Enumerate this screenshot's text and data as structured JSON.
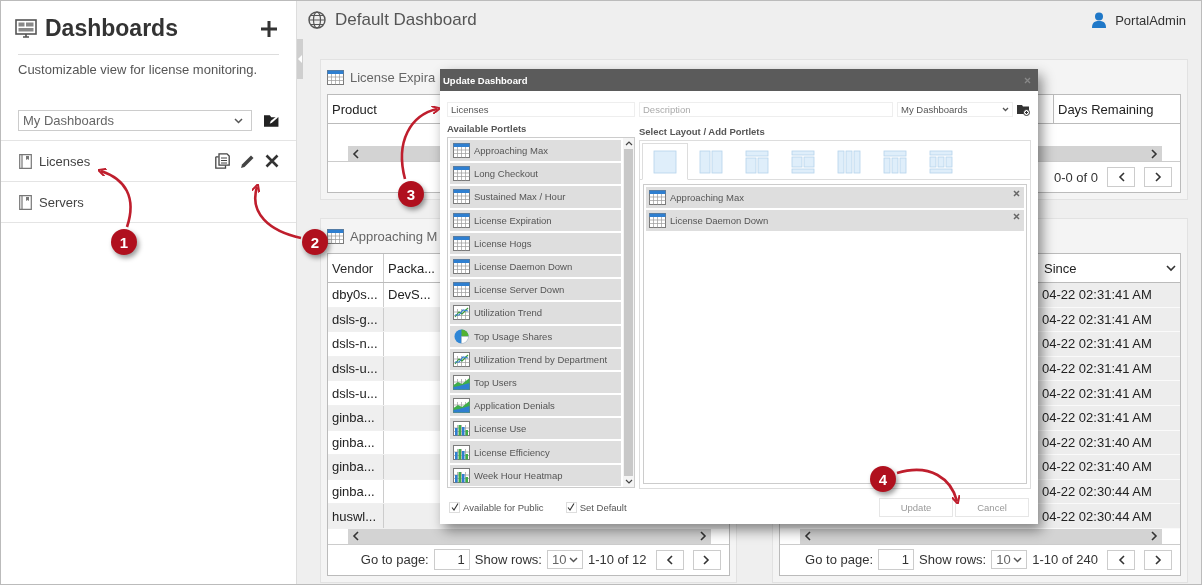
{
  "sidebar": {
    "title": "Dashboards",
    "description": "Customizable view for license monitoring.",
    "filter": {
      "value": "My Dashboards"
    },
    "items": [
      {
        "label": "Licenses",
        "actions": true
      },
      {
        "label": "Servers",
        "actions": false
      }
    ]
  },
  "header": {
    "title": "Default Dashboard",
    "user": "PortalAdmin"
  },
  "top_panel": {
    "title": "License Expira",
    "columns": [
      "Product",
      "Days Remaining"
    ],
    "pager": {
      "range": "0-0 of 0"
    }
  },
  "left_panel": {
    "title": "Approaching M",
    "columns": [
      "Vendor",
      "Packa..."
    ],
    "rows": [
      {
        "vendor": "dby0s...",
        "package": "DevS..."
      },
      {
        "vendor": "dsls-g..."
      },
      {
        "vendor": "dsls-n..."
      },
      {
        "vendor": "dsls-u..."
      },
      {
        "vendor": "dsls-u..."
      },
      {
        "vendor": "ginba..."
      },
      {
        "vendor": "ginba..."
      },
      {
        "vendor": "ginba..."
      },
      {
        "vendor": "ginba..."
      },
      {
        "vendor": "huswl..."
      }
    ],
    "pager": {
      "goto_label": "Go to page:",
      "page": "1",
      "rows_label": "Show rows:",
      "rows": "10",
      "range": "1-10 of 12"
    }
  },
  "right_panel": {
    "column": "Since",
    "rows": [
      "04-22 02:31:41 AM",
      "04-22 02:31:41 AM",
      "04-22 02:31:41 AM",
      "04-22 02:31:41 AM",
      "04-22 02:31:41 AM",
      "04-22 02:31:41 AM",
      "04-22 02:31:40 AM",
      "04-22 02:31:40 AM",
      "04-22 02:30:44 AM",
      "04-22 02:30:44 AM"
    ],
    "pager": {
      "goto_label": "Go to page:",
      "page": "1",
      "rows_label": "Show rows:",
      "rows": "10",
      "range": "1-10 of 240"
    }
  },
  "dialog": {
    "title": "Update Dashboard",
    "name": {
      "value": "Licenses"
    },
    "description": {
      "placeholder": "Description"
    },
    "group": {
      "value": "My Dashboards"
    },
    "available_label": "Available Portlets",
    "available": [
      {
        "label": "Approaching Max",
        "kind": "table"
      },
      {
        "label": "Long Checkout",
        "kind": "table"
      },
      {
        "label": "Sustained Max / Hour",
        "kind": "table"
      },
      {
        "label": "License Expiration",
        "kind": "table"
      },
      {
        "label": "License Hogs",
        "kind": "table"
      },
      {
        "label": "License Daemon Down",
        "kind": "table"
      },
      {
        "label": "License Server Down",
        "kind": "table"
      },
      {
        "label": "Utilization Trend",
        "kind": "line"
      },
      {
        "label": "Top Usage Shares",
        "kind": "pie"
      },
      {
        "label": "Utilization Trend by Department",
        "kind": "line"
      },
      {
        "label": "Top Users",
        "kind": "area"
      },
      {
        "label": "Application Denials",
        "kind": "area"
      },
      {
        "label": "License Use",
        "kind": "bar"
      },
      {
        "label": "License Efficiency",
        "kind": "bar"
      },
      {
        "label": "Week Hour Heatmap",
        "kind": "bar"
      }
    ],
    "layout_label": "Select Layout / Add Portlets",
    "layouts": [
      {
        "selected": true
      },
      {
        "selected": false
      },
      {
        "selected": false
      },
      {
        "selected": false
      },
      {
        "selected": false
      },
      {
        "selected": false
      },
      {
        "selected": false
      }
    ],
    "added": [
      {
        "label": "Approaching Max",
        "kind": "table"
      },
      {
        "label": "License Daemon Down",
        "kind": "table"
      }
    ],
    "options": [
      {
        "label": "Available for Public",
        "checked": true
      },
      {
        "label": "Set Default",
        "checked": true
      }
    ],
    "buttons": [
      "Update",
      "Cancel"
    ]
  },
  "annotations": [
    "1",
    "2",
    "3",
    "4"
  ]
}
